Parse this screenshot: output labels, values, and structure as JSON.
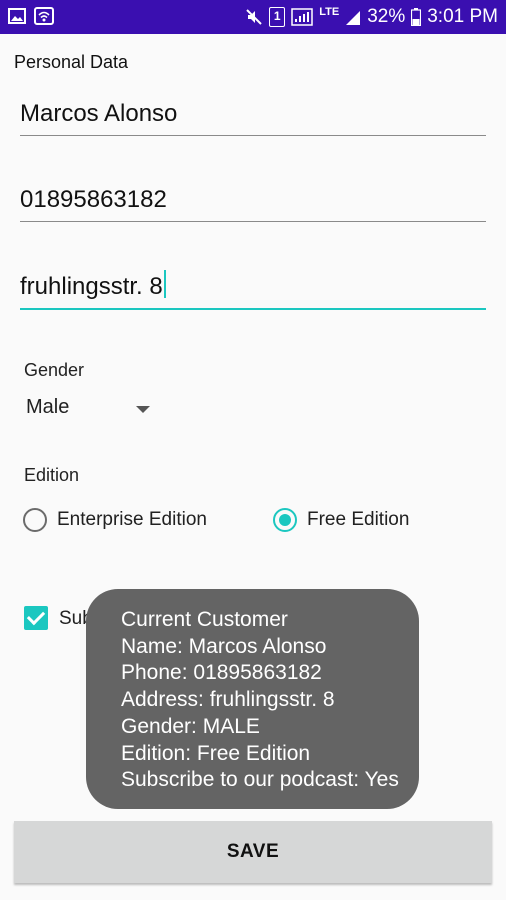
{
  "status_bar": {
    "battery": "32%",
    "time": "3:01 PM",
    "sim": "1",
    "network": "LTE",
    "background_color": "#3a0fb0"
  },
  "form": {
    "title": "Personal Data",
    "name_value": "Marcos Alonso",
    "phone_value": "01895863182",
    "address_value": "fruhlingsstr. 8",
    "gender_label": "Gender",
    "gender_value": "Male",
    "edition_label": "Edition",
    "edition_options": [
      "Enterprise Edition",
      "Free Edition"
    ],
    "edition_selected": "Free Edition",
    "subscribe_label": "Subscribe to our podcast",
    "subscribe_visible": "Subsc",
    "subscribe_checked": true,
    "accent_color": "#1bc7c0"
  },
  "toast": {
    "lines": [
      "Current Customer",
      "Name: Marcos Alonso",
      "Phone: 01895863182",
      "Address: fruhlingsstr. 8",
      "Gender: MALE",
      "Edition: Free Edition",
      "Subscribe to our podcast: Yes"
    ]
  },
  "save_button": {
    "label": "SAVE"
  }
}
